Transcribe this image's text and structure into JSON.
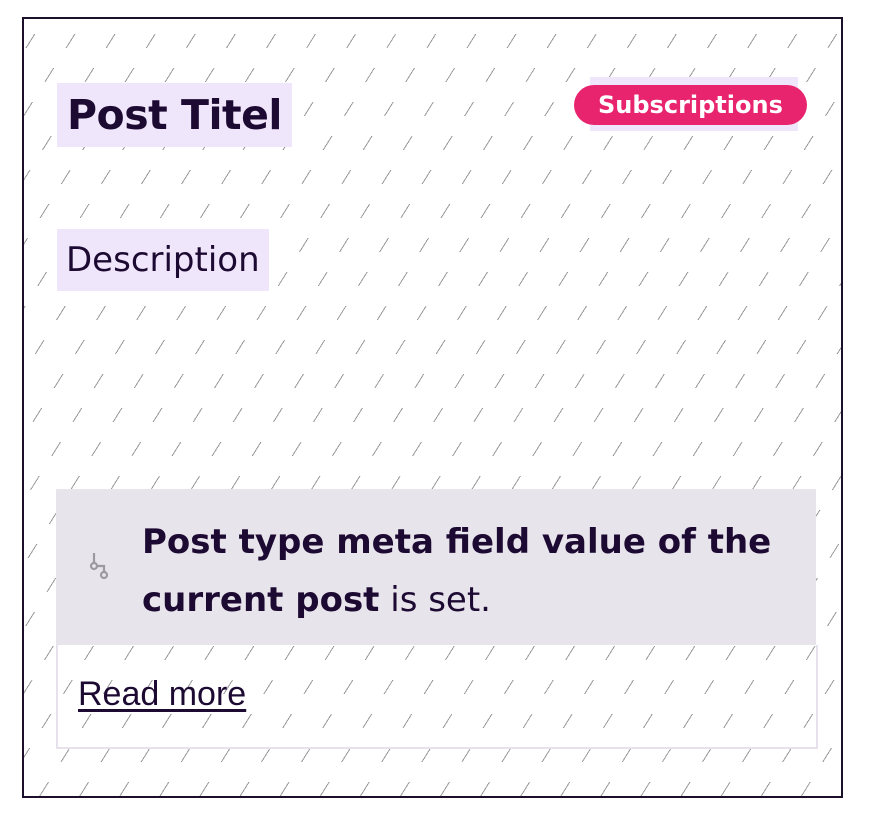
{
  "card": {
    "title": "Post Titel",
    "badge": "Subscriptions",
    "description": "Description",
    "condition": {
      "icon": "condition-branch-icon",
      "bold_text": "Post type meta field value of the current post",
      "rest_text": " is set."
    },
    "read_more": "Read more"
  },
  "colors": {
    "badge_bg": "#e8246f",
    "text": "#1d0a32",
    "highlight": "#f0e6fb",
    "condition_bg": "#e8e4ec"
  }
}
